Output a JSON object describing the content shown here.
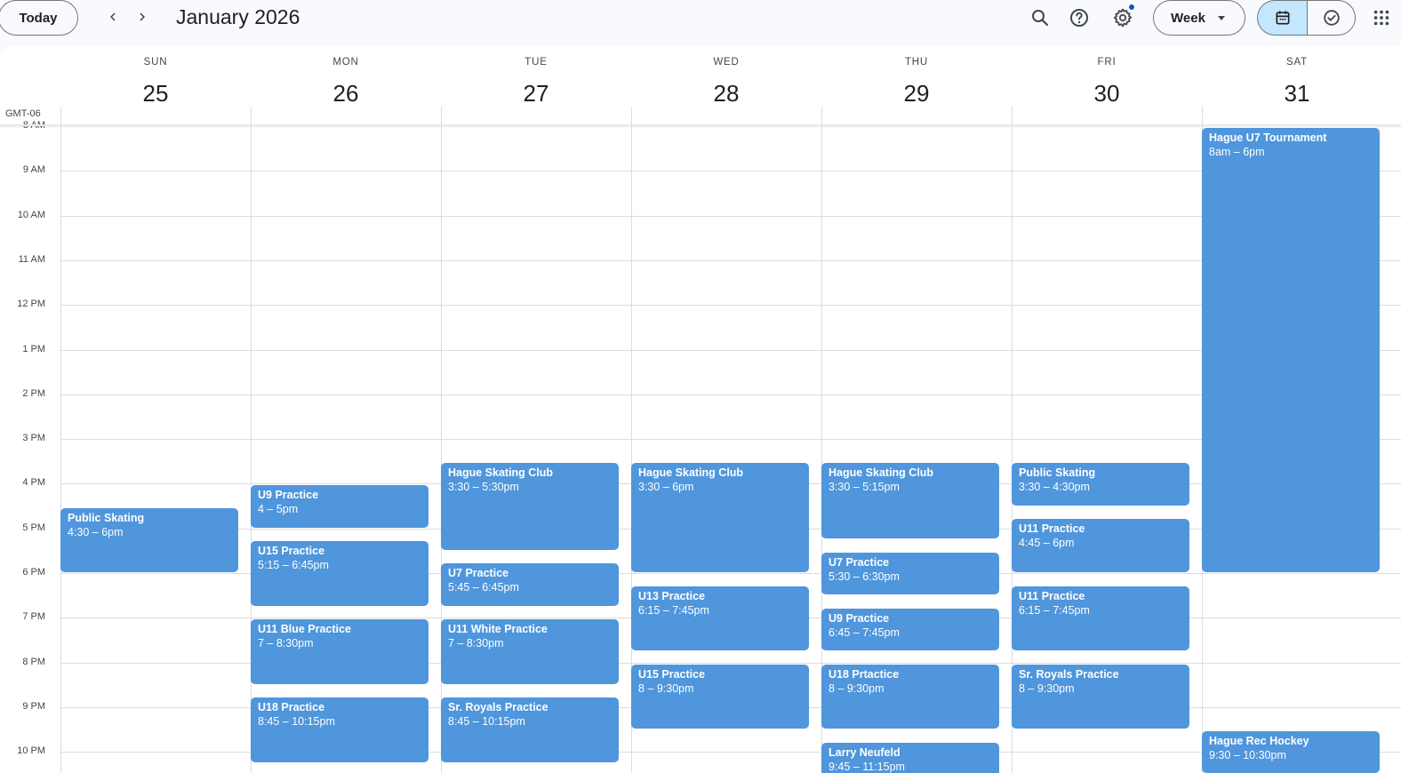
{
  "header": {
    "today_label": "Today",
    "month_title": "January 2026",
    "view_label": "Week",
    "icons": {
      "prev": "chevron-left-icon",
      "next": "chevron-right-icon",
      "search": "search-icon",
      "help": "help-icon",
      "settings": "gear-icon",
      "calendar_view": "calendar-icon",
      "tasks_view": "check-circle-icon",
      "apps": "apps-grid-icon"
    },
    "accent_color": "#c2e7ff"
  },
  "timezone": "GMT-06",
  "days": [
    {
      "name": "SUN",
      "num": "25"
    },
    {
      "name": "MON",
      "num": "26"
    },
    {
      "name": "TUE",
      "num": "27"
    },
    {
      "name": "WED",
      "num": "28"
    },
    {
      "name": "THU",
      "num": "29"
    },
    {
      "name": "FRI",
      "num": "30"
    },
    {
      "name": "SAT",
      "num": "31"
    }
  ],
  "hours": [
    "8 AM",
    "9 AM",
    "10 AM",
    "11 AM",
    "12 PM",
    "1 PM",
    "2 PM",
    "3 PM",
    "4 PM",
    "5 PM",
    "6 PM",
    "7 PM",
    "8 PM",
    "9 PM",
    "10 PM"
  ],
  "event_color": "#4f96dc",
  "events": [
    {
      "day": 0,
      "start": 16.5,
      "end": 18,
      "title": "Public Skating",
      "time": "4:30 – 6pm"
    },
    {
      "day": 1,
      "start": 16,
      "end": 17,
      "title": "U9 Practice",
      "time": "4 – 5pm"
    },
    {
      "day": 1,
      "start": 17.25,
      "end": 18.75,
      "title": "U15 Practice",
      "time": "5:15 – 6:45pm"
    },
    {
      "day": 1,
      "start": 19,
      "end": 20.5,
      "title": "U11 Blue Practice",
      "time": "7 – 8:30pm"
    },
    {
      "day": 1,
      "start": 20.75,
      "end": 22.25,
      "title": "U18 Practice",
      "time": "8:45 – 10:15pm"
    },
    {
      "day": 2,
      "start": 15.5,
      "end": 17.5,
      "title": "Hague Skating Club",
      "time": "3:30 – 5:30pm"
    },
    {
      "day": 2,
      "start": 17.75,
      "end": 18.75,
      "title": "U7 Practice",
      "time": "5:45 – 6:45pm"
    },
    {
      "day": 2,
      "start": 19,
      "end": 20.5,
      "title": "U11 White Practice",
      "time": "7 – 8:30pm"
    },
    {
      "day": 2,
      "start": 20.75,
      "end": 22.25,
      "title": "Sr. Royals Practice",
      "time": "8:45 – 10:15pm"
    },
    {
      "day": 3,
      "start": 15.5,
      "end": 18,
      "title": "Hague Skating Club",
      "time": "3:30 – 6pm"
    },
    {
      "day": 3,
      "start": 18.25,
      "end": 19.75,
      "title": "U13 Practice",
      "time": "6:15 – 7:45pm"
    },
    {
      "day": 3,
      "start": 20,
      "end": 21.5,
      "title": "U15 Practice",
      "time": "8 – 9:30pm"
    },
    {
      "day": 4,
      "start": 15.5,
      "end": 17.25,
      "title": "Hague Skating Club",
      "time": "3:30 – 5:15pm"
    },
    {
      "day": 4,
      "start": 17.5,
      "end": 18.5,
      "title": "U7 Practice",
      "time": "5:30 – 6:30pm"
    },
    {
      "day": 4,
      "start": 18.75,
      "end": 19.75,
      "title": "U9 Practice",
      "time": "6:45 – 7:45pm"
    },
    {
      "day": 4,
      "start": 20,
      "end": 21.5,
      "title": "U18 Prtactice",
      "time": "8 – 9:30pm"
    },
    {
      "day": 4,
      "start": 21.75,
      "end": 23.25,
      "title": "Larry Neufeld",
      "time": "9:45 – 11:15pm"
    },
    {
      "day": 5,
      "start": 15.5,
      "end": 16.5,
      "title": "Public Skating",
      "time": "3:30 – 4:30pm"
    },
    {
      "day": 5,
      "start": 16.75,
      "end": 18,
      "title": "U11 Practice",
      "time": "4:45 – 6pm"
    },
    {
      "day": 5,
      "start": 18.25,
      "end": 19.75,
      "title": "U11 Practice",
      "time": "6:15 – 7:45pm"
    },
    {
      "day": 5,
      "start": 20,
      "end": 21.5,
      "title": "Sr. Royals Practice",
      "time": "8 – 9:30pm"
    },
    {
      "day": 6,
      "start": 8,
      "end": 18,
      "title": "Hague U7 Tournament",
      "time": "8am – 6pm"
    },
    {
      "day": 6,
      "start": 21.5,
      "end": 22.5,
      "title": "Hague Rec Hockey",
      "time": "9:30 – 10:30pm"
    }
  ]
}
